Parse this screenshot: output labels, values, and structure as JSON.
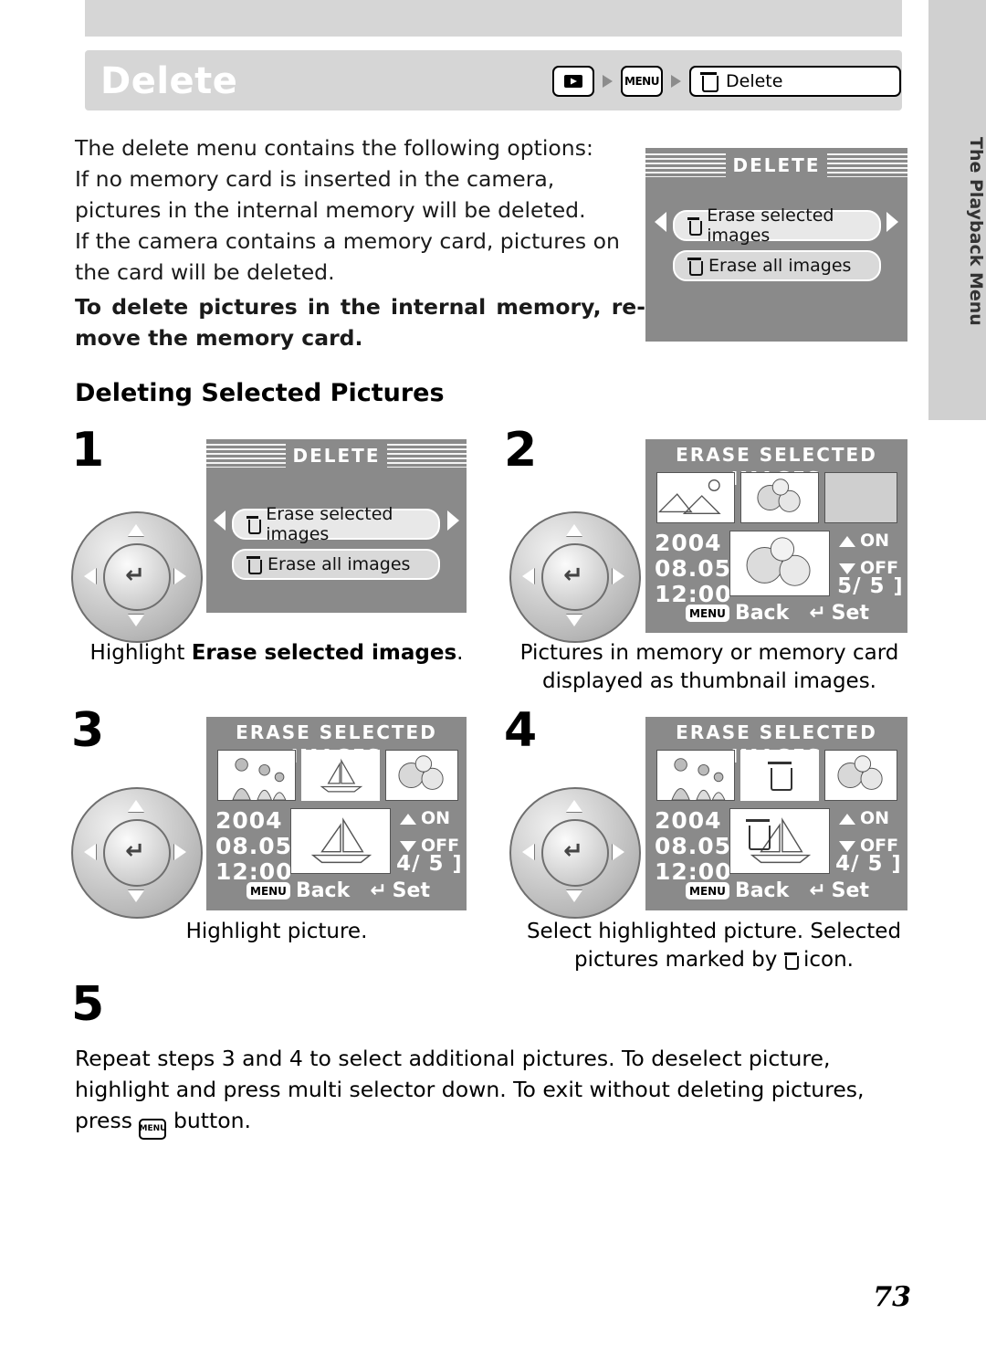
{
  "page": {
    "title": "Delete",
    "number": "73",
    "side_tab_label": "The Playback Menu"
  },
  "breadcrumb": {
    "playback_icon": "playback-icon",
    "menu_label": "MENU",
    "field_label": "Delete",
    "field_icon": "trash-icon"
  },
  "intro": {
    "line1": "The delete menu contains the following options:",
    "line2": "If no memory card is inserted in the camera, pictures in the internal memory will be deleted.",
    "line3": "If the camera contains a memory card, pictures on the card will be deleted.",
    "bold": "To delete pictures in the internal memory, re-move the memory card."
  },
  "section_title": "Deleting Selected Pictures",
  "top_lcd": {
    "title": "DELETE",
    "items": [
      {
        "label": "Erase selected images",
        "selected": true
      },
      {
        "label": "Erase all images",
        "selected": false
      }
    ]
  },
  "steps": [
    {
      "number": "1",
      "lcd_title": "DELETE",
      "items": [
        {
          "label": "Erase selected images",
          "selected": true
        },
        {
          "label": "Erase all images",
          "selected": false
        }
      ],
      "caption_plain_before": "Highlight ",
      "caption_bold": "Erase selected images",
      "caption_plain_after": "."
    },
    {
      "number": "2",
      "lcd_title": "ERASE SELECTED IMAGES",
      "date": "2004",
      "month_day": "08.05",
      "time": "12:00",
      "on_label": "ON",
      "off_label": "OFF",
      "back_label": "Back",
      "set_label": "Set",
      "menu_pill": "MENU",
      "counter": "5/ 5",
      "caption": "Pictures in memory or memory card displayed as thumbnail images."
    },
    {
      "number": "3",
      "lcd_title": "ERASE SELECTED IMAGES",
      "date": "2004",
      "month_day": "08.05",
      "time": "12:00",
      "on_label": "ON",
      "off_label": "OFF",
      "back_label": "Back",
      "set_label": "Set",
      "menu_pill": "MENU",
      "counter": "4/ 5",
      "caption": "Highlight picture."
    },
    {
      "number": "4",
      "lcd_title": "ERASE SELECTED IMAGES",
      "date": "2004",
      "month_day": "08.05",
      "time": "12:00",
      "on_label": "ON",
      "off_label": "OFF",
      "back_label": "Back",
      "set_label": "Set",
      "menu_pill": "MENU",
      "counter": "4/ 5",
      "caption_before": "Select highlighted picture. Selected pictures marked by ",
      "caption_after": " icon."
    },
    {
      "number": "5",
      "text_before": "Repeat steps 3 and 4 to select additional pictures. To deselect picture, highlight and press multi selector down. To exit without deleting pictures, press ",
      "text_after": " button."
    }
  ]
}
